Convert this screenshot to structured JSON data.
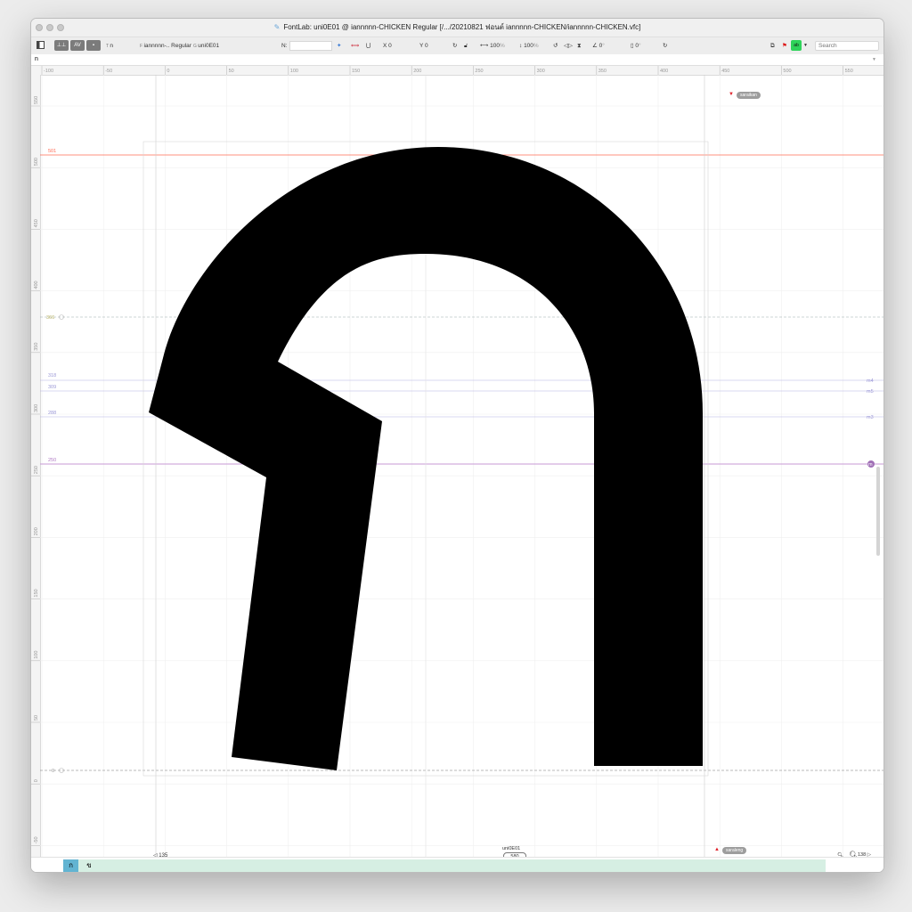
{
  "window": {
    "title": "FontLab: uni0E01 @ iannnnn-CHICKEN Regular [/.../20210821 ฟอนต์ iannnnn-CHICKEN/iannnnn-CHICKEN.vfc]"
  },
  "toolbar": {
    "text_tool_label": "n",
    "font_name": "iannnnn-.. Regular",
    "glyph_name": "uni0E01",
    "node_label": "N:",
    "x_label": "X",
    "x_value": "0",
    "y_label": "Y",
    "y_value": "0",
    "width_scale": "100",
    "height_scale": "100",
    "percent_unit": "%",
    "angle_value": "0",
    "slant_value": "0",
    "degree_unit": "°",
    "badge_value": "ab",
    "search_placeholder": "Search"
  },
  "text_bar": {
    "value": "n"
  },
  "ruler": {
    "h_ticks": [
      "-100",
      "-50",
      "0",
      "50",
      "100",
      "150",
      "200",
      "250",
      "300",
      "350",
      "400",
      "450",
      "500",
      "550"
    ],
    "v_ticks": [
      "550",
      "500",
      "450",
      "400",
      "350",
      "300",
      "250",
      "200",
      "150",
      "100",
      "50",
      "0",
      "-50"
    ]
  },
  "guides": {
    "cap_label": "501",
    "xheight_label": "366",
    "m4_label": "318",
    "m5_label": "309",
    "m3_label": "288",
    "mid_label": "250",
    "base_label": "0",
    "right_m4": "m4",
    "right_m5": "m5",
    "right_m3": "m3",
    "right_mid": "m"
  },
  "anchors": {
    "top_anchor": "saraikan",
    "bottom_anchor": "saraleng"
  },
  "metrics": {
    "glyph_name": "uni0E01",
    "advance_width": "580",
    "left_sidebearing": "135",
    "right_sidebearing": "138"
  },
  "glyph_strip": {
    "active_char": "ก",
    "next_char": "ข"
  },
  "colors": {
    "accent_green": "#2ed35a",
    "strip_bg": "#d6efe3",
    "active_tab": "#62b4d2",
    "metric_red": "#ff6b55",
    "guide_purple": "#c79ad6",
    "anchor_red": "#e0222b"
  },
  "icons": {
    "panel": "sidebar-toggle-icon",
    "kerning": "kerning-icon",
    "metrics": "metrics-icon",
    "search_zoom": "zoom-icon"
  }
}
